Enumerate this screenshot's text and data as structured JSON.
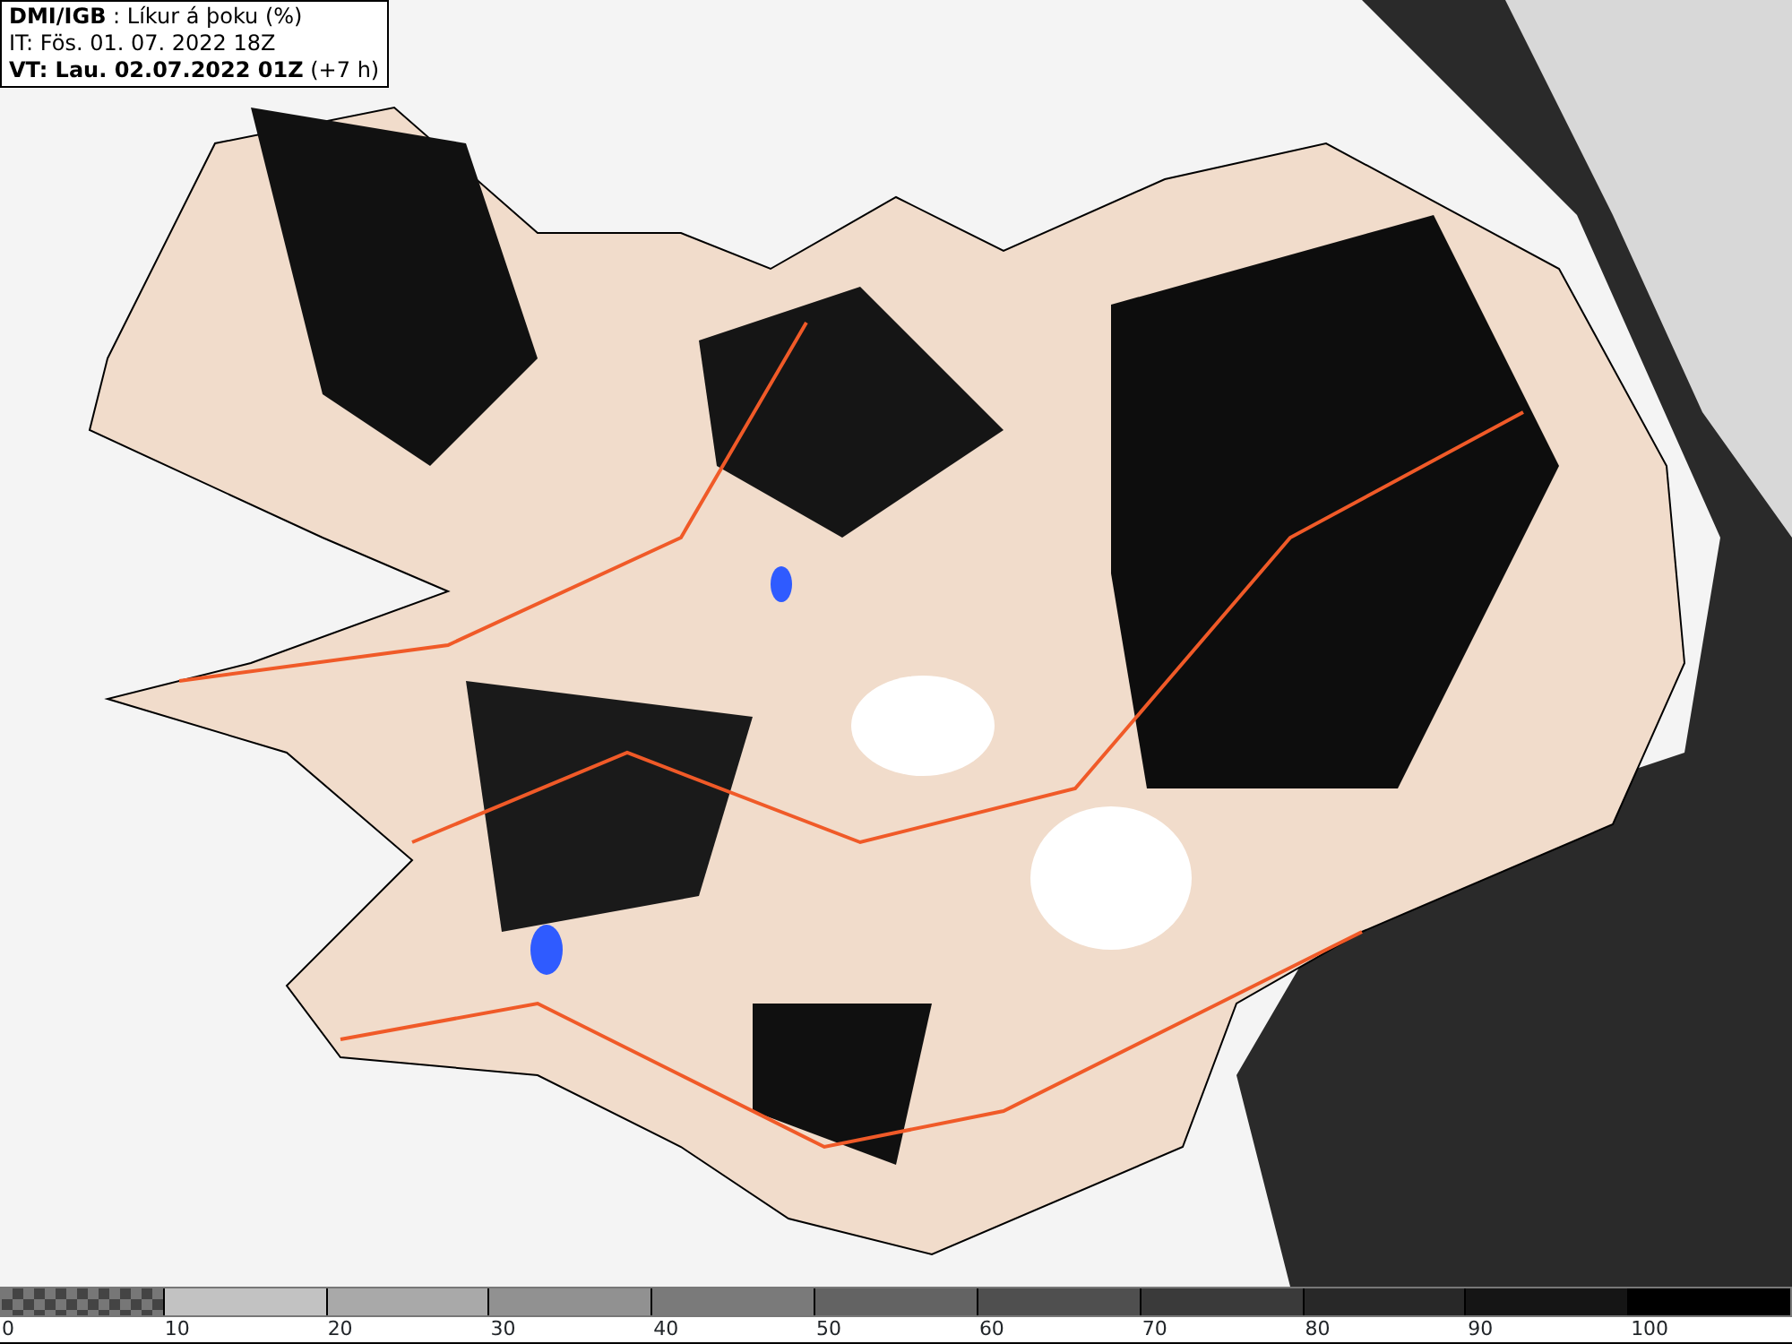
{
  "info_box": {
    "lines": [
      "**DMI/IGB** : Líkur á þoku (%)",
      "IT: Fös. 01. 07. 2022 18Z",
      "**VT: Lau. 02.07.2022 01Z** (+7 h)"
    ]
  },
  "legend": [
    {
      "kind": "checker",
      "color": "#6e6e6e",
      "label": "0"
    },
    {
      "kind": "solid",
      "color": "#c2c2c2",
      "label": "10"
    },
    {
      "kind": "solid",
      "color": "#a9a9a9",
      "label": "20"
    },
    {
      "kind": "solid",
      "color": "#919191",
      "label": "30"
    },
    {
      "kind": "solid",
      "color": "#7a7a7a",
      "label": "40"
    },
    {
      "kind": "solid",
      "color": "#636363",
      "label": "50"
    },
    {
      "kind": "solid",
      "color": "#4f4f4f",
      "label": "60"
    },
    {
      "kind": "solid",
      "color": "#3a3a3a",
      "label": "70"
    },
    {
      "kind": "solid",
      "color": "#282828",
      "label": "80"
    },
    {
      "kind": "solid",
      "color": "#151515",
      "label": "90"
    },
    {
      "kind": "solid",
      "color": "#000000",
      "label": "100"
    }
  ]
}
